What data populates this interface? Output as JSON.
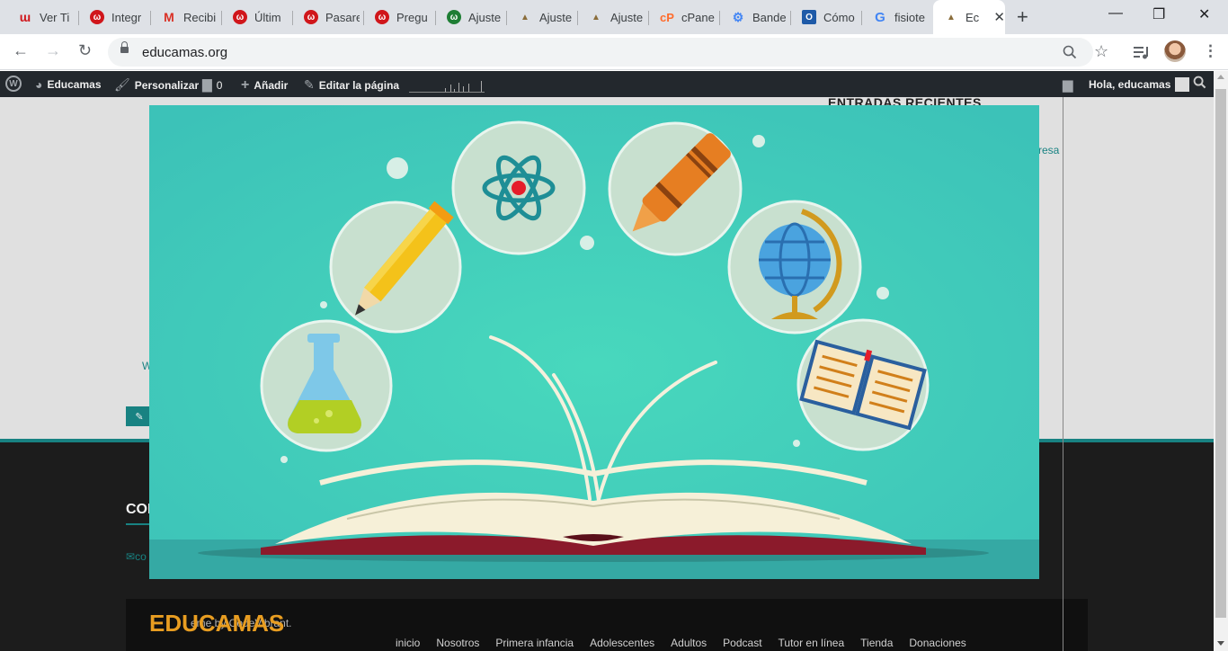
{
  "browser": {
    "tabs": [
      {
        "title": "Ver Ti",
        "icon": "w-red-icon",
        "color": "#e8e8e8"
      },
      {
        "title": "Integr",
        "icon": "w-circle-icon",
        "color": "#d0161b"
      },
      {
        "title": "Recibi",
        "icon": "gmail-icon",
        "color": "#d93025"
      },
      {
        "title": "Últim",
        "icon": "w-circle-icon",
        "color": "#d0161b"
      },
      {
        "title": "Pasare",
        "icon": "w-circle-icon",
        "color": "#d0161b"
      },
      {
        "title": "Pregu",
        "icon": "w-circle-icon",
        "color": "#d0161b"
      },
      {
        "title": "Ajuste",
        "icon": "w-green-icon",
        "color": "#1e7e34"
      },
      {
        "title": "Ajuste",
        "icon": "educamas-icon",
        "color": "#8a6d3b"
      },
      {
        "title": "Ajuste",
        "icon": "educamas-icon",
        "color": "#8a6d3b"
      },
      {
        "title": "cPane",
        "icon": "cpanel-icon",
        "color": "#ff6c2c"
      },
      {
        "title": "Bande",
        "icon": "gear-icon",
        "color": "#4285f4"
      },
      {
        "title": "Cómo",
        "icon": "outlook-icon",
        "color": "#1e5aa8"
      },
      {
        "title": "fisiote",
        "icon": "google-icon",
        "color": "#4285f4"
      }
    ],
    "active_tab": {
      "title": "Ec",
      "close": "✕"
    },
    "new_tab": "+",
    "window_controls": {
      "minimize": "—",
      "maximize": "❐",
      "close": "✕"
    },
    "url": "educamas.org"
  },
  "adminbar": {
    "site_name": "Educamas",
    "customize": "Personalizar",
    "comments_count": "0",
    "add_new": "Añadir",
    "edit_page": "Editar la página",
    "greeting": "Hola, educamas"
  },
  "page": {
    "widget_title": "ENTRADAS RECIENTES",
    "sidebar_link_fragment": "resa",
    "content_fragment": "W",
    "footer_heading": "CON",
    "footer_mail_fragment": "co",
    "site_logo": "EDUCAMAS",
    "credit": "eme by CodeVibrant.",
    "footer_nav": [
      "inicio",
      "Nosotros",
      "Primera infancia",
      "Adolescentes",
      "Adultos",
      "Podcast",
      "Tutor en línea",
      "Tienda",
      "Donaciones"
    ]
  },
  "hero_image": {
    "icons": [
      "flask-icon",
      "pencil-icon",
      "atom-icon",
      "crayon-icon",
      "globe-icon",
      "book-icon",
      "open-book-icon"
    ],
    "colors": {
      "background": "#45c6b6",
      "circle": "#c8e0cf",
      "book_cover": "#8b1a2b"
    }
  }
}
